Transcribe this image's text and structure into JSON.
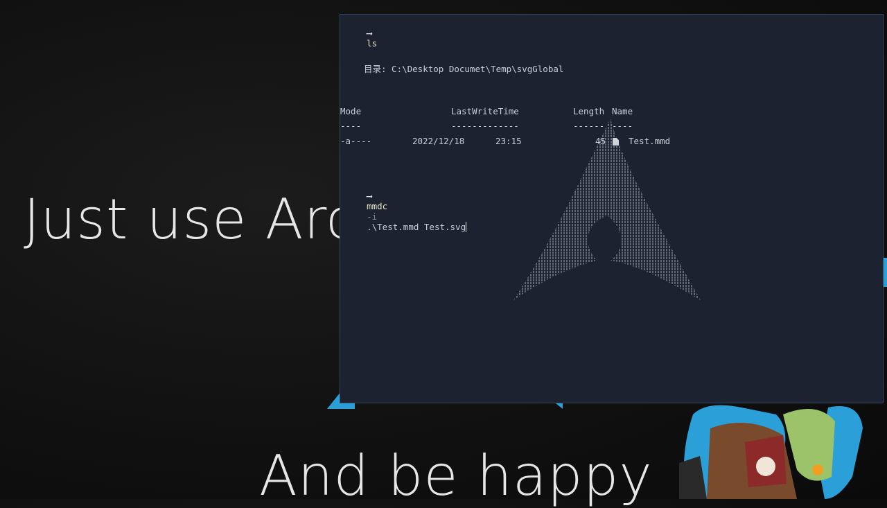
{
  "background": {
    "headline": "Just use Arc",
    "subline": "And be happy"
  },
  "terminal": {
    "prompt_icon": "arrow-right-icon",
    "commands": [
      {
        "name": "ls",
        "flag": "",
        "args": ""
      },
      {
        "name": "mmdc",
        "flag": "-i",
        "args": ".\\Test.mmd Test.svg"
      }
    ],
    "directory_label": "目录: C:\\Desktop Documet\\Temp\\svgGlobal",
    "headers": {
      "mode": "Mode",
      "lastwrite": "LastWriteTime",
      "length": "Length",
      "name": "Name"
    },
    "underlines": {
      "mode": "----",
      "lastwrite": "-------------",
      "length": "------",
      "name": "----"
    },
    "rows": [
      {
        "mode": "-a----",
        "date": "2022/12/18",
        "time": "23:15",
        "length": "45",
        "icon": "file-icon",
        "name": "Test.mmd"
      }
    ]
  },
  "colors": {
    "terminal_bg": "#1d2230",
    "accent_blue": "#2a9fd8",
    "text": "#c9cfd8",
    "command": "#e8e6c8"
  }
}
